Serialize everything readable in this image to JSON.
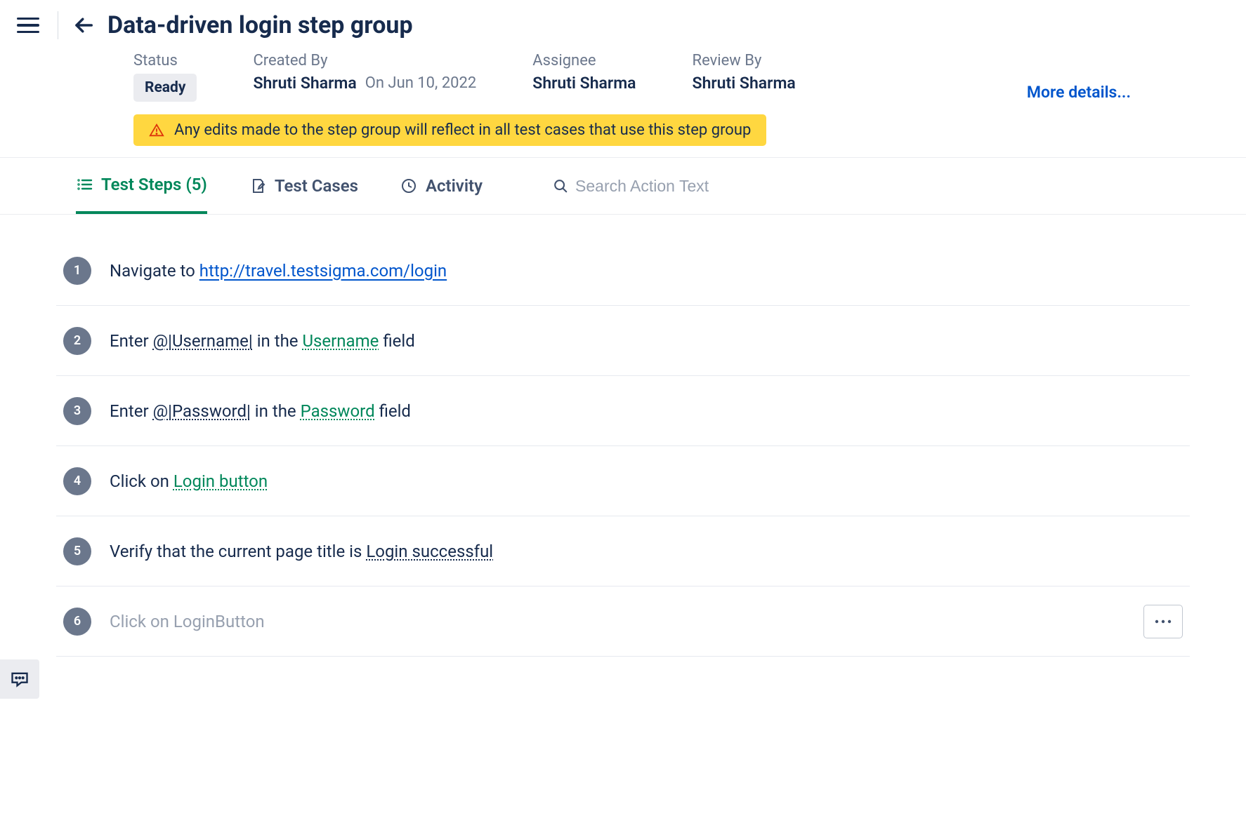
{
  "header": {
    "title": "Data-driven login step group"
  },
  "meta": {
    "status_label": "Status",
    "status_value": "Ready",
    "created_by_label": "Created By",
    "created_by_value": "Shruti Sharma",
    "created_on": "On Jun 10, 2022",
    "assignee_label": "Assignee",
    "assignee_value": "Shruti Sharma",
    "review_by_label": "Review By",
    "review_by_value": "Shruti Sharma",
    "more_details": "More details..."
  },
  "warning": "Any edits made to the step group will reflect in all test cases that use this step group",
  "tabs": {
    "test_steps": "Test Steps (5)",
    "test_cases": "Test Cases",
    "activity": "Activity"
  },
  "search": {
    "placeholder": "Search Action Text"
  },
  "steps": [
    {
      "num": "1",
      "parts": [
        {
          "kind": "text",
          "value": "Navigate to "
        },
        {
          "kind": "url",
          "value": "http://travel.testsigma.com/login"
        }
      ]
    },
    {
      "num": "2",
      "parts": [
        {
          "kind": "text",
          "value": "Enter "
        },
        {
          "kind": "param",
          "value": "@|Username|"
        },
        {
          "kind": "text",
          "value": " in the "
        },
        {
          "kind": "element",
          "value": "Username"
        },
        {
          "kind": "text",
          "value": " field"
        }
      ]
    },
    {
      "num": "3",
      "parts": [
        {
          "kind": "text",
          "value": "Enter "
        },
        {
          "kind": "param",
          "value": "@|Password|"
        },
        {
          "kind": "text",
          "value": " in the "
        },
        {
          "kind": "element",
          "value": "Password"
        },
        {
          "kind": "text",
          "value": " field"
        }
      ]
    },
    {
      "num": "4",
      "parts": [
        {
          "kind": "text",
          "value": "Click on "
        },
        {
          "kind": "element",
          "value": "Login button"
        }
      ]
    },
    {
      "num": "5",
      "parts": [
        {
          "kind": "text",
          "value": "Verify that the current page title is "
        },
        {
          "kind": "valtxt",
          "value": "Login successful"
        }
      ]
    },
    {
      "num": "6",
      "placeholder": "Click on LoginButton",
      "has_more": true
    }
  ]
}
